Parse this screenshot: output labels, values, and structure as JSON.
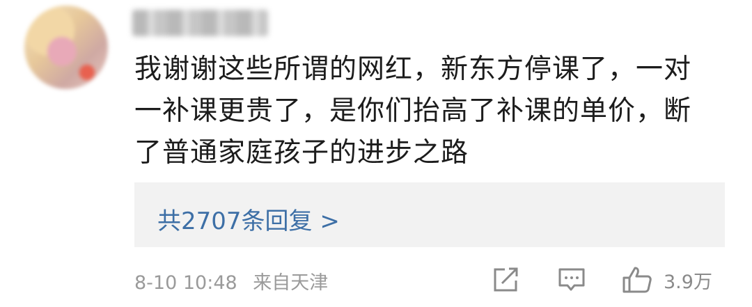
{
  "comment": {
    "lines": [
      "我谢谢这些所谓的网红，新东方停课了，一对",
      "一补课更贵了，是你们抬高了补课的单价，断",
      "了普通家庭孩子的进步之路"
    ],
    "replies_label": "共2707条回复 >",
    "date": "8-10 10:48",
    "location": "来自天津",
    "like_count": "3.9万"
  },
  "icons": {
    "share": "share-icon",
    "reply": "comment-icon",
    "like": "thumbs-up-icon"
  },
  "colors": {
    "text": "#1c1c1c",
    "link": "#3d6fa6",
    "meta": "#9a9a9a",
    "reply_box_bg": "#f2f2f2"
  }
}
